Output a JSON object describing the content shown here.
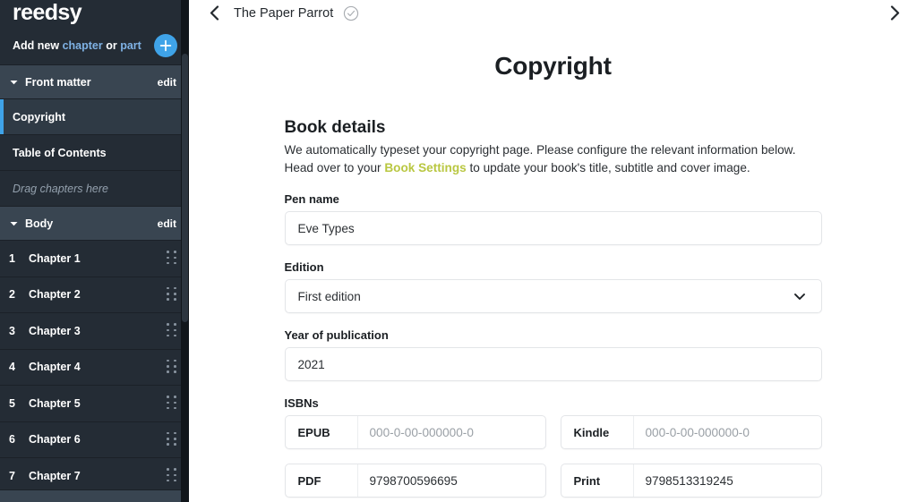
{
  "sidebar": {
    "logo": "reedsy",
    "add_new": {
      "prefix": "Add new",
      "link_chapter": "chapter",
      "separator": "or",
      "link_part": "part",
      "plus_icon": "plus-icon"
    },
    "front_matter": {
      "title": "Front matter",
      "edit_label": "edit",
      "items": [
        {
          "label": "Copyright",
          "selected": true
        },
        {
          "label": "Table of Contents",
          "selected": false
        }
      ],
      "drop_hint": "Drag chapters here"
    },
    "body": {
      "title": "Body",
      "edit_label": "edit",
      "chapters": [
        {
          "num": "1",
          "title": "Chapter 1"
        },
        {
          "num": "2",
          "title": "Chapter 2"
        },
        {
          "num": "3",
          "title": "Chapter 3"
        },
        {
          "num": "4",
          "title": "Chapter 4"
        },
        {
          "num": "5",
          "title": "Chapter 5"
        },
        {
          "num": "6",
          "title": "Chapter 6"
        },
        {
          "num": "7",
          "title": "Chapter 7"
        }
      ]
    },
    "colors": {
      "background": "#242c35",
      "section_header": "#394551",
      "selected_row": "#2f3a45",
      "accent_blue": "#3fa3e8",
      "link_blue": "#7fb2e5"
    }
  },
  "topbar": {
    "back_icon": "chevron-left-icon",
    "forward_icon": "chevron-right-icon",
    "book_title": "The Paper Parrot",
    "status_icon": "check-circle-icon"
  },
  "main": {
    "page_title": "Copyright",
    "section": {
      "heading": "Book details",
      "desc_line1": "We automatically typeset your copyright page. Please configure the relevant information below.",
      "desc_line2_before": "Head over to your ",
      "desc_link": "Book Settings",
      "desc_line2_after": " to update your book's title, subtitle and cover image.",
      "link_color": "#b9c741"
    },
    "fields": {
      "pen_name": {
        "label": "Pen name",
        "value": "Eve Types"
      },
      "edition": {
        "label": "Edition",
        "value": "First edition",
        "caret_icon": "chevron-down-icon"
      },
      "year": {
        "label": "Year of publication",
        "value": "2021"
      },
      "isbns": {
        "label": "ISBNs",
        "entries": [
          {
            "tag": "EPUB",
            "value": "000-0-00-000000-0",
            "is_placeholder": true
          },
          {
            "tag": "Kindle",
            "value": "000-0-00-000000-0",
            "is_placeholder": true
          },
          {
            "tag": "PDF",
            "value": "9798700596695",
            "is_placeholder": false
          },
          {
            "tag": "Print",
            "value": "9798513319245",
            "is_placeholder": false
          }
        ]
      }
    }
  }
}
